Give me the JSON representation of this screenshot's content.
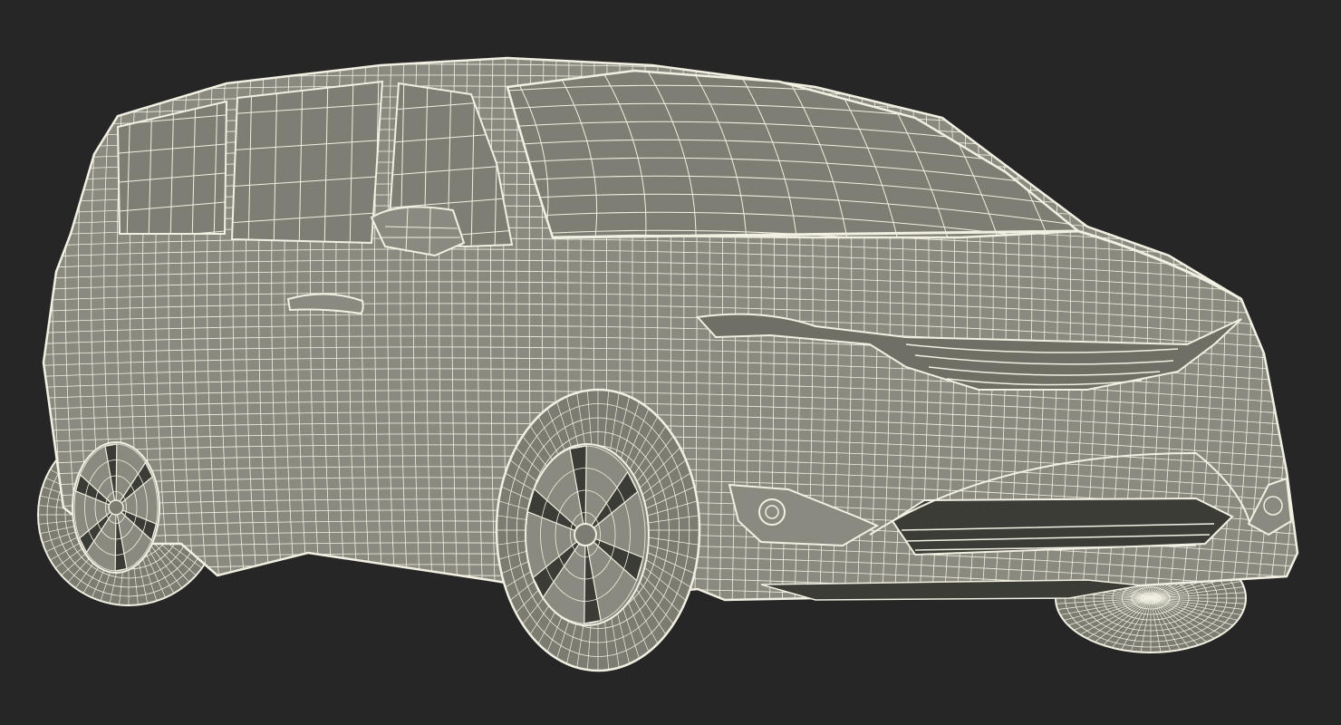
{
  "scene": {
    "subject": "minivan-wireframe-render",
    "colors": {
      "background": "#262626",
      "body_fill": "#8a8a80",
      "body_shade": "#6f6f66",
      "glass_fill": "#7e7e74",
      "tire_fill": "#7c7c73",
      "wire": "#f2f0e2",
      "dark_gap": "#3c3c37"
    }
  }
}
